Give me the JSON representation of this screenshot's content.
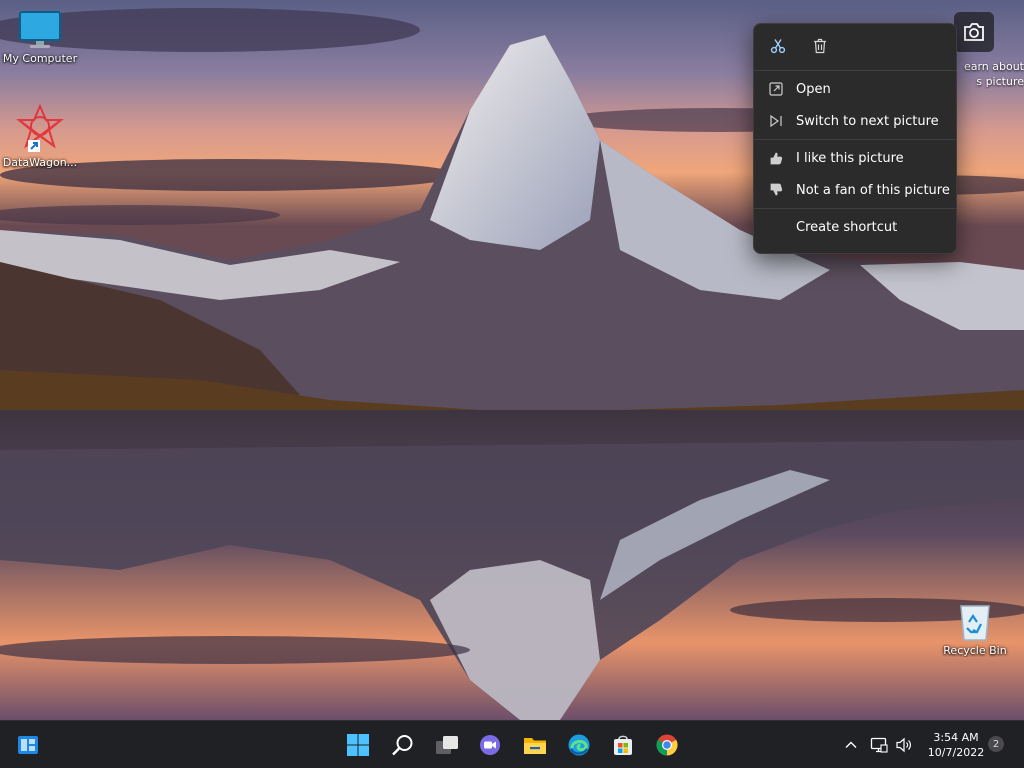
{
  "desktop": {
    "icons": [
      {
        "label": "My Computer",
        "icon": "monitor-icon"
      },
      {
        "label": "DataWagon...",
        "icon": "datawagon-app-icon",
        "shortcut": true
      },
      {
        "label": "Recycle Bin",
        "icon": "recycle-bin-icon"
      }
    ],
    "learn_about": {
      "label_line1": "earn about",
      "label_line2": "s picture",
      "icon": "camera-icon"
    },
    "wallpaper": "mountain-lake-sunset"
  },
  "context_menu": {
    "quick_actions": [
      {
        "name": "cut",
        "icon": "cut-icon"
      },
      {
        "name": "delete",
        "icon": "trash-icon"
      }
    ],
    "items": [
      {
        "label": "Open",
        "icon": "open-icon"
      },
      {
        "label": "Switch to next picture",
        "icon": "next-icon"
      },
      {
        "label": "I like this picture",
        "icon": "thumbs-up-icon"
      },
      {
        "label": "Not a fan of this picture",
        "icon": "thumbs-down-icon"
      },
      {
        "label": "Create shortcut",
        "icon": ""
      }
    ]
  },
  "taskbar": {
    "left": [
      {
        "name": "widgets",
        "icon": "widgets-icon"
      }
    ],
    "center": [
      {
        "name": "start",
        "icon": "windows-start-icon"
      },
      {
        "name": "search",
        "icon": "search-icon"
      },
      {
        "name": "task-view",
        "icon": "task-view-icon"
      },
      {
        "name": "chat",
        "icon": "teams-chat-icon"
      },
      {
        "name": "file-explorer",
        "icon": "folder-icon"
      },
      {
        "name": "edge",
        "icon": "edge-icon"
      },
      {
        "name": "store",
        "icon": "store-icon"
      },
      {
        "name": "chrome",
        "icon": "chrome-icon"
      }
    ],
    "tray": {
      "chevron_icon": "chevron-up-icon",
      "network_icon": "network-icon",
      "volume_icon": "volume-icon",
      "time": "3:54 AM",
      "date": "10/7/2022",
      "notification_count": "2"
    }
  },
  "colors": {
    "taskbar_bg": "#202124",
    "menu_bg": "#2b2b2b",
    "accent": "#0078d4"
  }
}
